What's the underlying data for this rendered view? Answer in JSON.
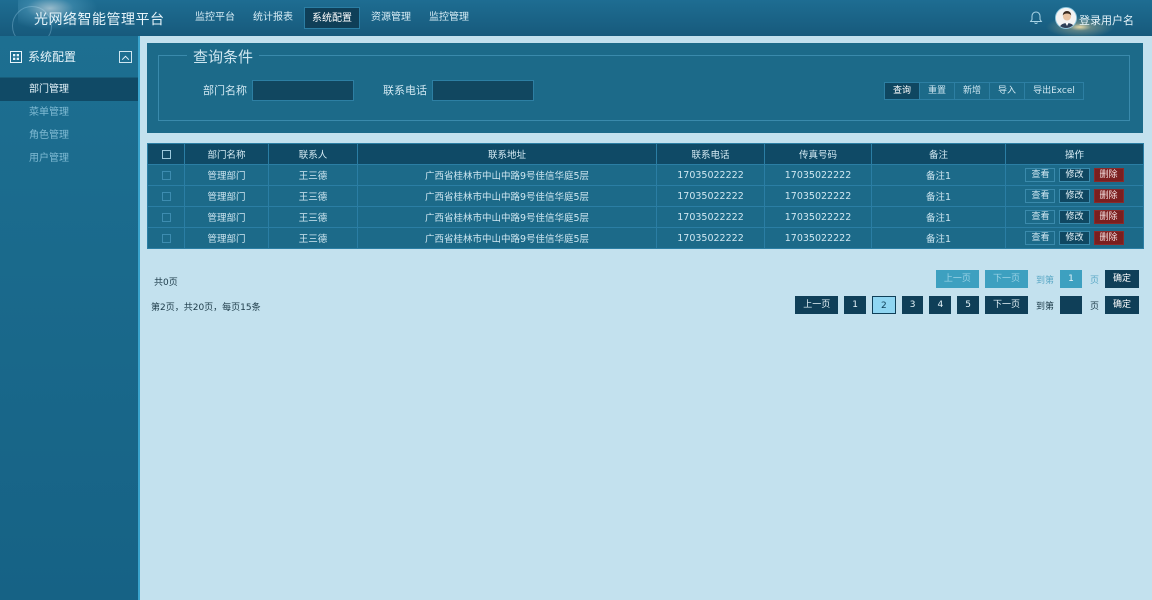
{
  "header": {
    "app_title": "光网络智能管理平台",
    "nav": [
      "监控平台",
      "统计报表",
      "系统配置",
      "资源管理",
      "监控管理"
    ],
    "active_nav_index": 2,
    "user_name": "登录用户名"
  },
  "sidebar": {
    "title": "系统配置",
    "items": [
      {
        "label": "部门管理",
        "active": true
      },
      {
        "label": "菜单管理",
        "active": false
      },
      {
        "label": "角色管理",
        "active": false
      },
      {
        "label": "用户管理",
        "active": false
      }
    ]
  },
  "query": {
    "legend": "查询条件",
    "dept_label": "部门名称",
    "dept_value": "",
    "phone_label": "联系电话",
    "phone_value": "",
    "buttons": [
      "查询",
      "重置",
      "新增",
      "导入",
      "导出Excel"
    ]
  },
  "table": {
    "headers": [
      "部门名称",
      "联系人",
      "联系地址",
      "联系电话",
      "传真号码",
      "备注",
      "操作"
    ],
    "rows": [
      {
        "dept": "管理部门",
        "contact": "王三德",
        "address": "广西省桂林市中山中路9号佳信华庭5层",
        "phone": "17035022222",
        "fax": "17035022222",
        "remark": "备注1"
      },
      {
        "dept": "管理部门",
        "contact": "王三德",
        "address": "广西省桂林市中山中路9号佳信华庭5层",
        "phone": "17035022222",
        "fax": "17035022222",
        "remark": "备注1"
      },
      {
        "dept": "管理部门",
        "contact": "王三德",
        "address": "广西省桂林市中山中路9号佳信华庭5层",
        "phone": "17035022222",
        "fax": "17035022222",
        "remark": "备注1"
      },
      {
        "dept": "管理部门",
        "contact": "王三德",
        "address": "广西省桂林市中山中路9号佳信华庭5层",
        "phone": "17035022222",
        "fax": "17035022222",
        "remark": "备注1"
      }
    ],
    "actions": {
      "view": "查看",
      "edit": "修改",
      "delete": "删除"
    }
  },
  "pager1": {
    "summary": "共0页",
    "prev": "上一页",
    "next": "下一页",
    "goto_label": "到第",
    "page_value": "1",
    "page_unit": "页",
    "confirm": "确定"
  },
  "pager2": {
    "summary": "第2页，共20页，每页15条",
    "prev": "上一页",
    "pages": [
      "1",
      "2",
      "3",
      "4",
      "5"
    ],
    "current_page": "2",
    "next": "下一页",
    "goto_label": "到第",
    "page_value": "",
    "page_unit": "页",
    "confirm": "确定"
  },
  "colors": {
    "header_bg": "#1e6d92",
    "sidebar_bg": "#1d6f91",
    "content_bg": "#c3e1ee",
    "panel_bg": "#1c6a89",
    "dark_accent": "#0f3f58",
    "delete_red": "#7a1f1f"
  }
}
